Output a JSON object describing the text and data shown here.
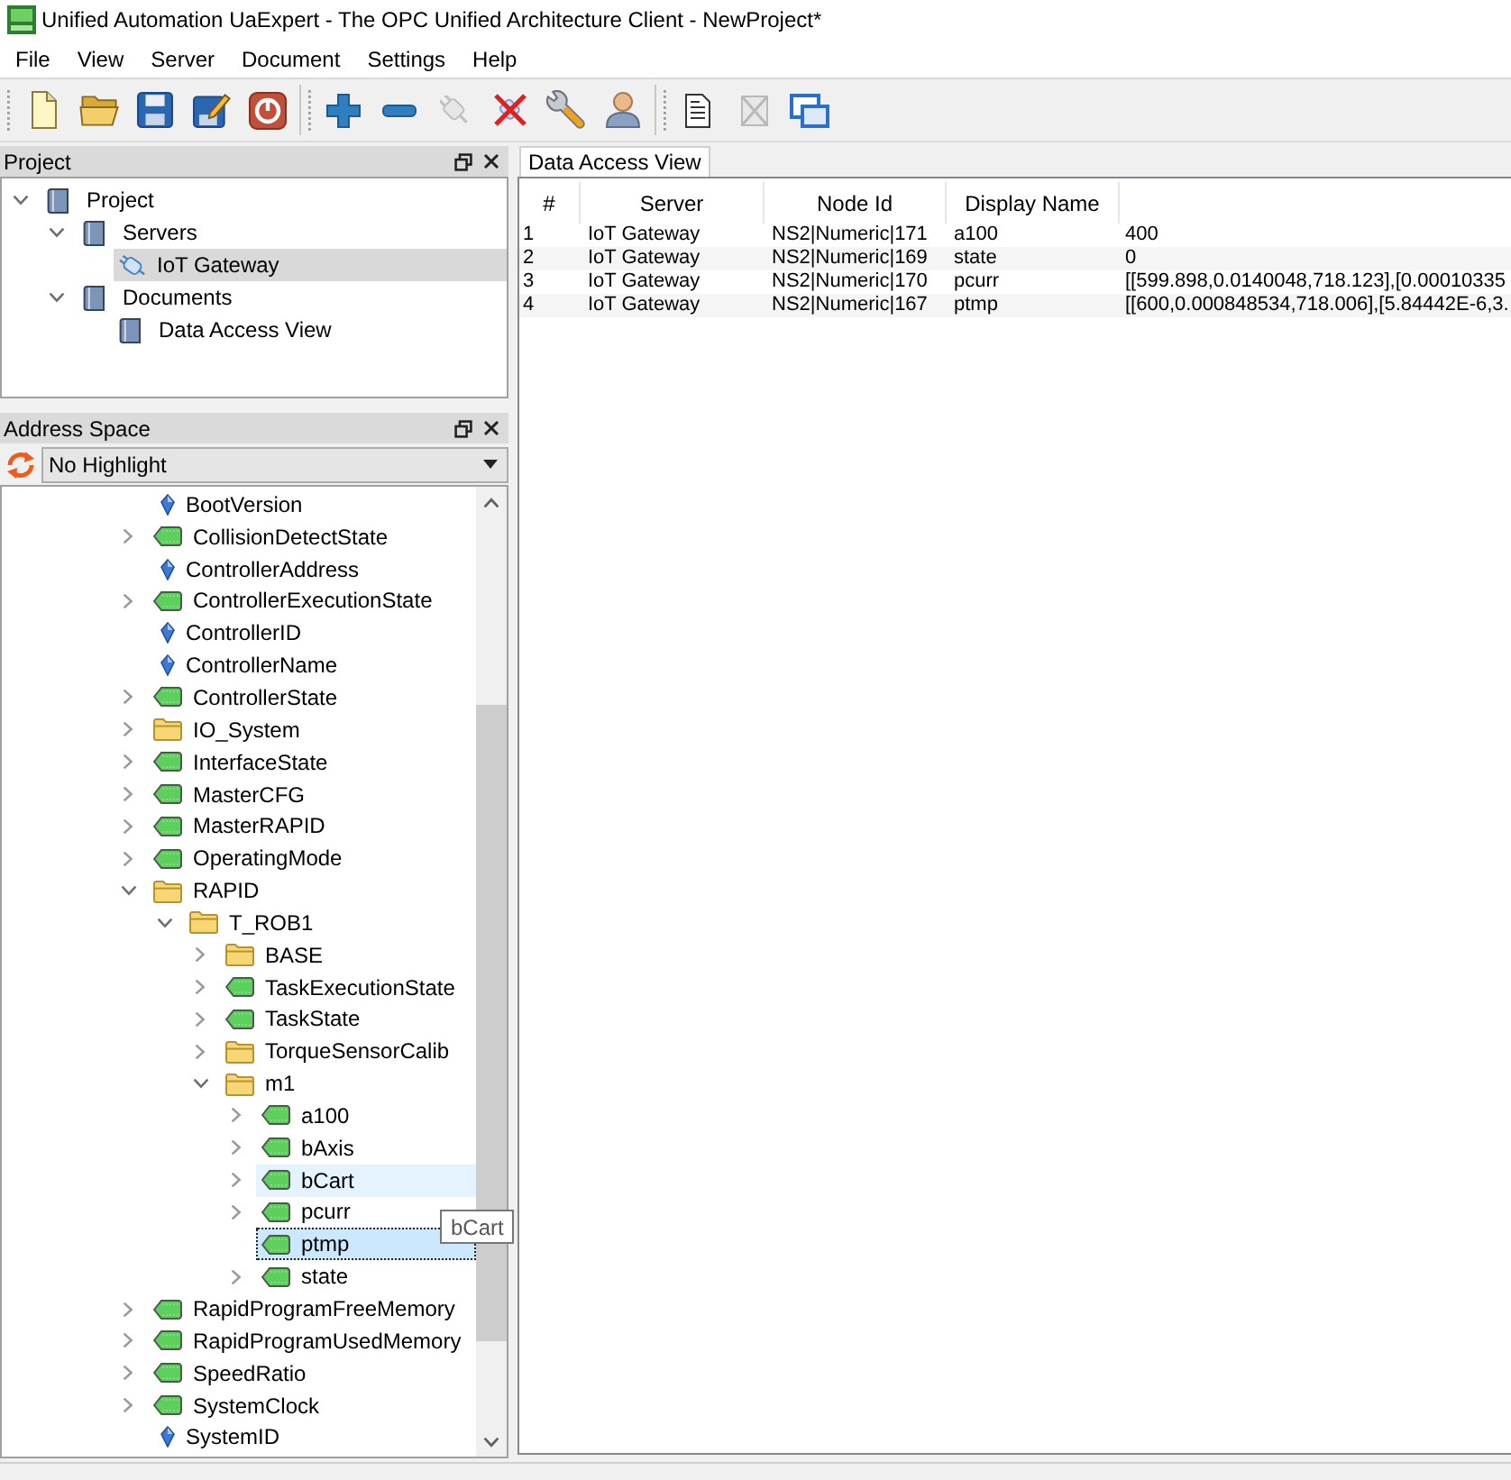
{
  "window": {
    "title": "Unified Automation UaExpert - The OPC Unified Architecture Client - NewProject*"
  },
  "menu": [
    "File",
    "View",
    "Server",
    "Document",
    "Settings",
    "Help"
  ],
  "toolbar": {
    "groups": [
      {
        "buttons": [
          {
            "disabled": false
          },
          {
            "disabled": false
          },
          {
            "disabled": false
          },
          {
            "disabled": false
          },
          {
            "disabled": false
          }
        ]
      },
      {
        "buttons": [
          {
            "disabled": false
          },
          {
            "disabled": false
          },
          {
            "disabled": true
          },
          {
            "disabled": false
          },
          {
            "disabled": false
          },
          {
            "disabled": false
          }
        ]
      },
      {
        "buttons": [
          {
            "disabled": false
          },
          {
            "disabled": true
          },
          {
            "disabled": false
          }
        ]
      }
    ]
  },
  "project_panel": {
    "title": "Project",
    "tree": [
      {
        "label": "Project",
        "kind": "book",
        "expanded": true,
        "selected": false,
        "children": [
          {
            "label": "Servers",
            "kind": "book",
            "expanded": true,
            "selected": false,
            "children": [
              {
                "label": "IoT Gateway",
                "kind": "server",
                "selected": true
              }
            ]
          },
          {
            "label": "Documents",
            "kind": "book",
            "expanded": true,
            "selected": false,
            "children": [
              {
                "label": "Data Access View",
                "kind": "book",
                "selected": false
              }
            ]
          }
        ]
      }
    ]
  },
  "address_space_panel": {
    "title": "Address Space",
    "highlight_filter": {
      "value": "No Highlight"
    },
    "tree": [
      {
        "label": "BootVersion",
        "kind": "property",
        "selected": false,
        "hovered": false
      },
      {
        "label": "CollisionDetectState",
        "kind": "variable",
        "expanded": false,
        "selected": false,
        "hovered": false
      },
      {
        "label": "ControllerAddress",
        "kind": "property",
        "selected": false,
        "hovered": false
      },
      {
        "label": "ControllerExecutionState",
        "kind": "variable",
        "expanded": false,
        "selected": false,
        "hovered": false
      },
      {
        "label": "ControllerID",
        "kind": "property",
        "selected": false,
        "hovered": false
      },
      {
        "label": "ControllerName",
        "kind": "property",
        "selected": false,
        "hovered": false
      },
      {
        "label": "ControllerState",
        "kind": "variable",
        "expanded": false,
        "selected": false,
        "hovered": false
      },
      {
        "label": "IO_System",
        "kind": "folder",
        "expanded": false,
        "selected": false,
        "hovered": false
      },
      {
        "label": "InterfaceState",
        "kind": "variable",
        "expanded": false,
        "selected": false,
        "hovered": false
      },
      {
        "label": "MasterCFG",
        "kind": "variable",
        "expanded": false,
        "selected": false,
        "hovered": false
      },
      {
        "label": "MasterRAPID",
        "kind": "variable",
        "expanded": false,
        "selected": false,
        "hovered": false
      },
      {
        "label": "OperatingMode",
        "kind": "variable",
        "expanded": false,
        "selected": false,
        "hovered": false
      },
      {
        "label": "RAPID",
        "kind": "folder",
        "expanded": true,
        "selected": false,
        "hovered": false,
        "children": [
          {
            "label": "T_ROB1",
            "kind": "folder",
            "expanded": true,
            "selected": false,
            "hovered": false,
            "children": [
              {
                "label": "BASE",
                "kind": "folder",
                "expanded": false,
                "selected": false,
                "hovered": false
              },
              {
                "label": "TaskExecutionState",
                "kind": "variable",
                "expanded": false,
                "selected": false,
                "hovered": false
              },
              {
                "label": "TaskState",
                "kind": "variable",
                "expanded": false,
                "selected": false,
                "hovered": false
              },
              {
                "label": "TorqueSensorCalib",
                "kind": "folder",
                "expanded": false,
                "selected": false,
                "hovered": false
              },
              {
                "label": "m1",
                "kind": "folder",
                "expanded": true,
                "selected": false,
                "hovered": false,
                "children": [
                  {
                    "label": "a100",
                    "kind": "variable",
                    "expanded": false,
                    "selected": false,
                    "hovered": false
                  },
                  {
                    "label": "bAxis",
                    "kind": "variable",
                    "expanded": false,
                    "selected": false,
                    "hovered": false
                  },
                  {
                    "label": "bCart",
                    "kind": "variable",
                    "expanded": false,
                    "selected": false,
                    "hovered": true
                  },
                  {
                    "label": "pcurr",
                    "kind": "variable",
                    "expanded": false,
                    "selected": false,
                    "hovered": false
                  },
                  {
                    "label": "ptmp",
                    "kind": "variable",
                    "selected": true,
                    "hovered": false
                  },
                  {
                    "label": "state",
                    "kind": "variable",
                    "expanded": false,
                    "selected": false,
                    "hovered": false
                  }
                ]
              }
            ]
          }
        ]
      },
      {
        "label": "RapidProgramFreeMemory",
        "kind": "variable",
        "expanded": false,
        "selected": false,
        "hovered": false
      },
      {
        "label": "RapidProgramUsedMemory",
        "kind": "variable",
        "expanded": false,
        "selected": false,
        "hovered": false
      },
      {
        "label": "SpeedRatio",
        "kind": "variable",
        "expanded": false,
        "selected": false,
        "hovered": false
      },
      {
        "label": "SystemClock",
        "kind": "variable",
        "expanded": false,
        "selected": false,
        "hovered": false
      },
      {
        "label": "SystemID",
        "kind": "property",
        "selected": false,
        "hovered": false
      }
    ],
    "tooltip": {
      "text": "bCart"
    }
  },
  "data_access_view": {
    "tab": {
      "label": "Data Access View",
      "selected": true
    },
    "table": {
      "columns": [
        "#",
        "Server",
        "Node Id",
        "Display Name"
      ],
      "rows": [
        {
          "cells": [
            "1",
            "IoT Gateway",
            "NS2|Numeric|171",
            "a100",
            "400"
          ]
        },
        {
          "cells": [
            "2",
            "IoT Gateway",
            "NS2|Numeric|169",
            "state",
            "0"
          ]
        },
        {
          "cells": [
            "3",
            "IoT Gateway",
            "NS2|Numeric|170",
            "pcurr",
            "[[599.898,0.0140048,718.123],[0.00010335"
          ]
        },
        {
          "cells": [
            "4",
            "IoT Gateway",
            "NS2|Numeric|167",
            "ptmp",
            "[[600,0.000848534,718.006],[5.84442E-6,3."
          ]
        }
      ]
    }
  }
}
